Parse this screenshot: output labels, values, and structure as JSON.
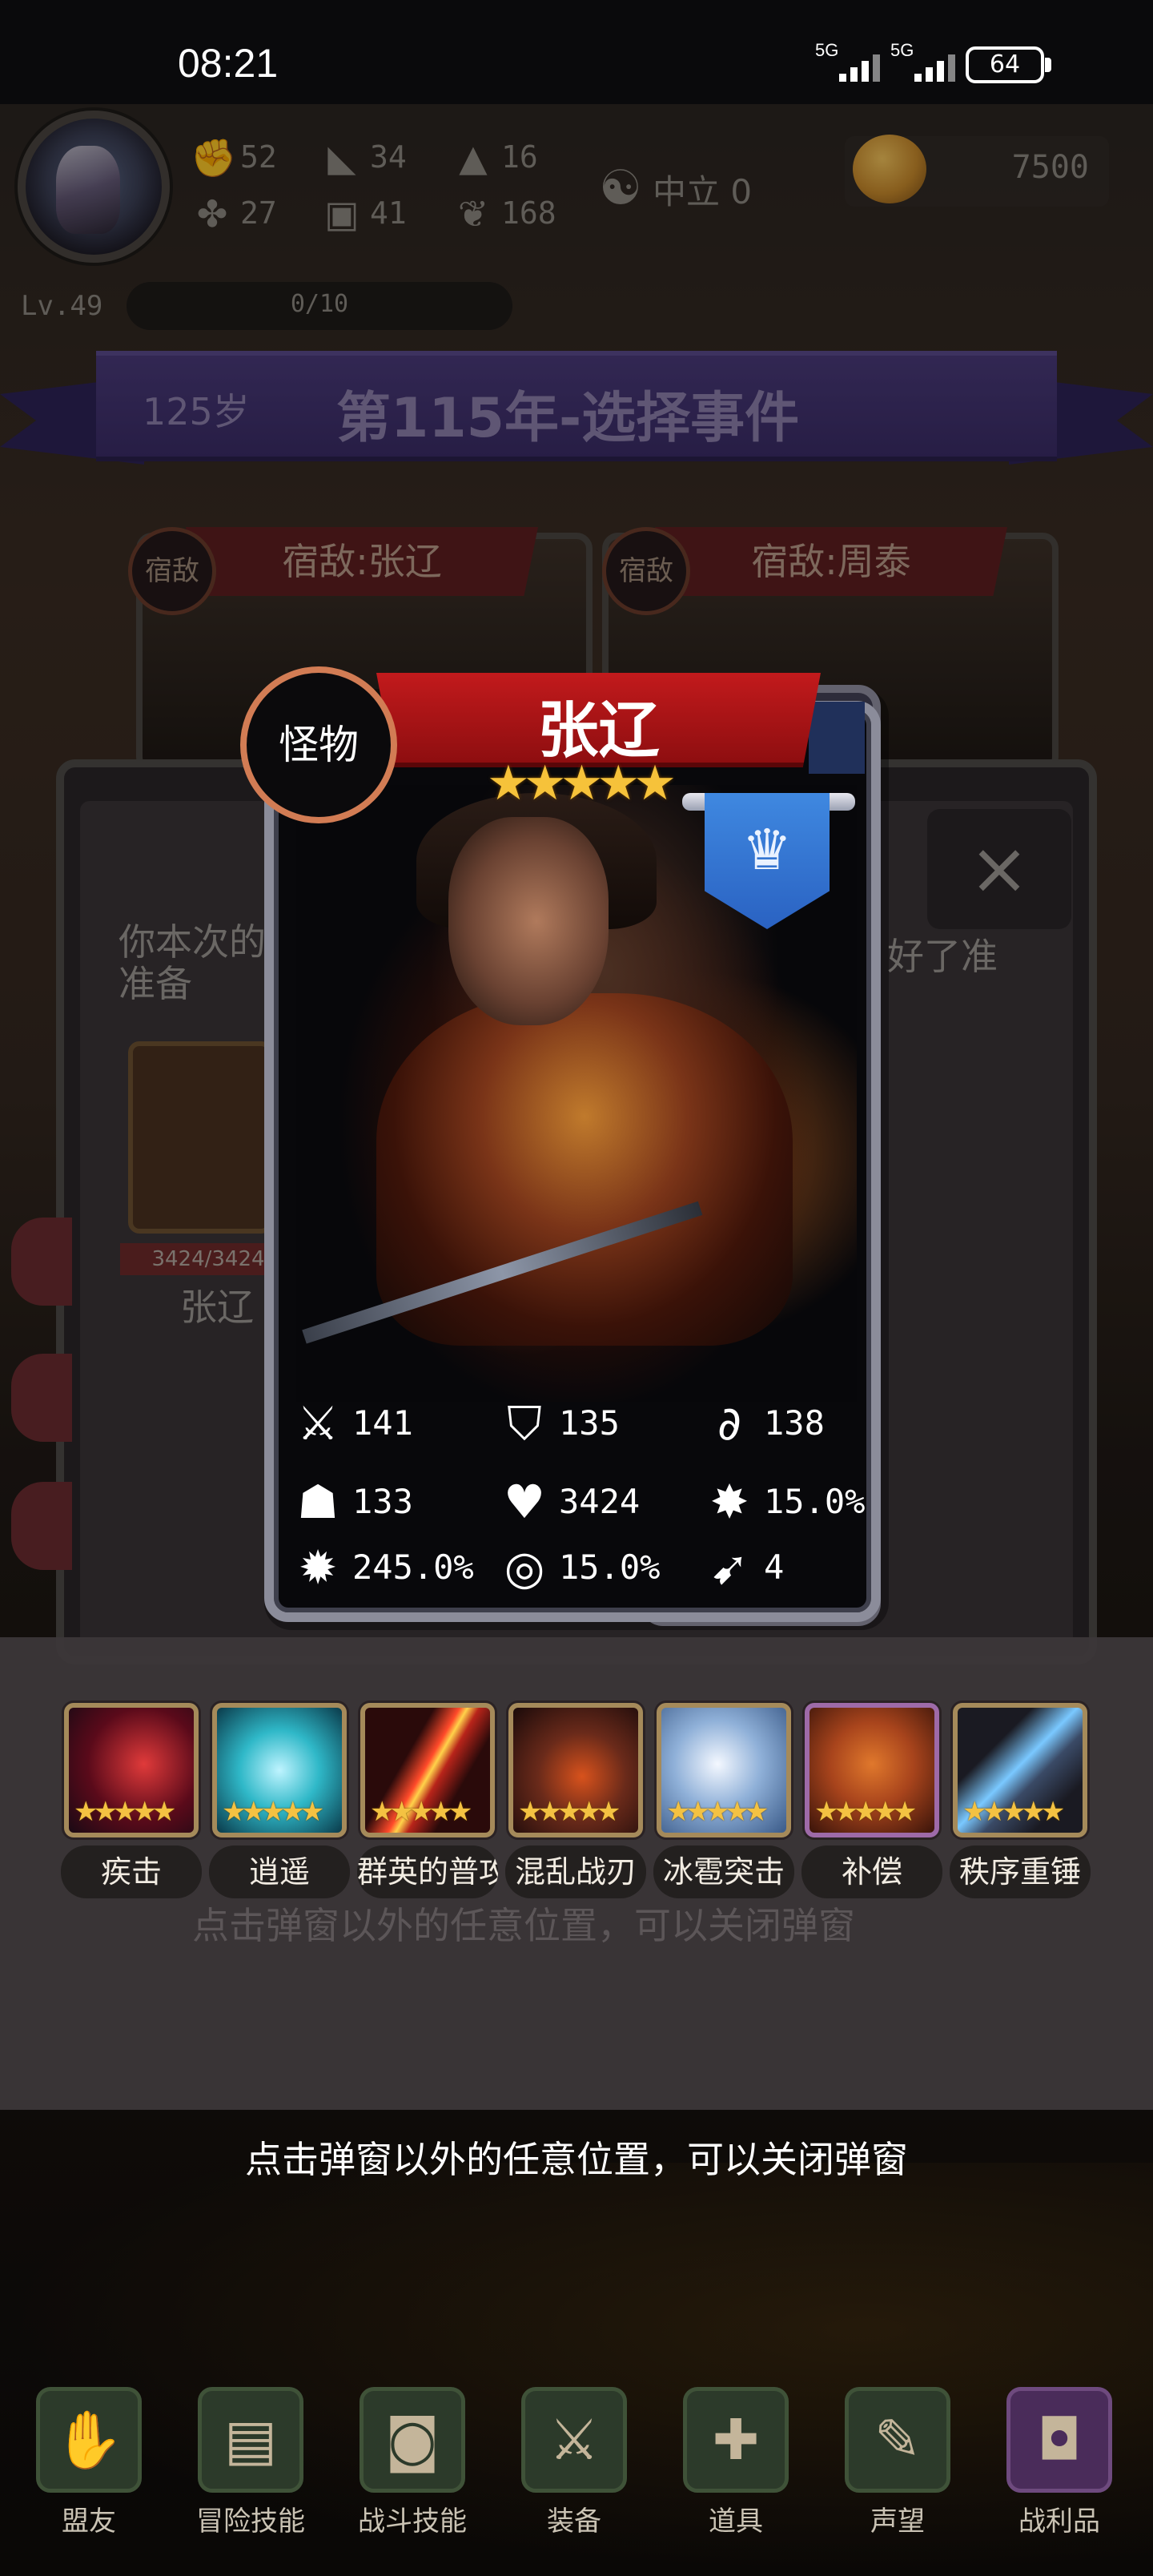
{
  "status_bar": {
    "time": "08:21",
    "signal_1": "5G",
    "signal_2": "5G",
    "battery": "64"
  },
  "player": {
    "stats": [
      {
        "icon": "fist-icon",
        "value": "52"
      },
      {
        "icon": "boot-icon",
        "value": "34"
      },
      {
        "icon": "wizard-hat-icon",
        "value": "16"
      },
      {
        "icon": "clover-icon",
        "value": "27"
      },
      {
        "icon": "armor-icon",
        "value": "41"
      },
      {
        "icon": "leaf-icon",
        "value": "168"
      }
    ],
    "alignment": "中立 0",
    "gold": "7500",
    "level": "Lv.49",
    "exp": "0/10"
  },
  "banner": {
    "age": "125岁",
    "title": "第115年-选择事件"
  },
  "rivals": [
    {
      "tag": "宿敌",
      "title": "宿敌:张辽"
    },
    {
      "tag": "宿敌",
      "title": "宿敌:周泰"
    }
  ],
  "background_panel": {
    "close": "×",
    "text_left": "你本次的准备",
    "text_right": "好了准",
    "mini_hp": "3424/3424",
    "mini_name": "张辽"
  },
  "monster_card": {
    "type": "怪物",
    "name": "张辽",
    "stars": "★★★★★",
    "rarity": 5,
    "stats": [
      {
        "icon": "sword-icon",
        "value": "141"
      },
      {
        "icon": "shield-icon",
        "value": "135"
      },
      {
        "icon": "magic-icon",
        "value": "138"
      },
      {
        "icon": "helmet-icon",
        "value": "133"
      },
      {
        "icon": "heart-icon",
        "value": "3424"
      },
      {
        "icon": "crit-icon",
        "value": "15.0%"
      },
      {
        "icon": "crit-damage-icon",
        "value": "245.0%"
      },
      {
        "icon": "tornado-icon",
        "value": "15.0%"
      },
      {
        "icon": "speed-boot-icon",
        "value": "4"
      }
    ]
  },
  "skills": [
    {
      "name": "疾击",
      "stars": "★★★★★",
      "color": "#8e1a2a"
    },
    {
      "name": "逍遥",
      "stars": "★★★★★",
      "color": "#2fb8c8"
    },
    {
      "name": "群英的普攻",
      "stars": "★★★★★",
      "color": "#b8241a"
    },
    {
      "name": "混乱战刃",
      "stars": "★★★★★",
      "color": "#6a2a1a"
    },
    {
      "name": "冰雹突击",
      "stars": "★★★★★",
      "color": "#8fb0d8"
    },
    {
      "name": "补偿",
      "stars": "★★★★★",
      "color": "#a8441c"
    },
    {
      "name": "秩序重锤",
      "stars": "★★★★★",
      "color": "#3a4a66"
    }
  ],
  "hint": "点击弹窗以外的任意位置，可以关闭弹窗",
  "nav": [
    {
      "label": "盟友",
      "icon": "handshake-icon"
    },
    {
      "label": "冒险技能",
      "icon": "book-icon"
    },
    {
      "label": "战斗技能",
      "icon": "backpack-icon"
    },
    {
      "label": "装备",
      "icon": "crossed-swords-icon"
    },
    {
      "label": "道具",
      "icon": "bag-icon"
    },
    {
      "label": "声望",
      "icon": "scroll-icon"
    },
    {
      "label": "战利品",
      "icon": "treasure-chest-icon"
    }
  ]
}
